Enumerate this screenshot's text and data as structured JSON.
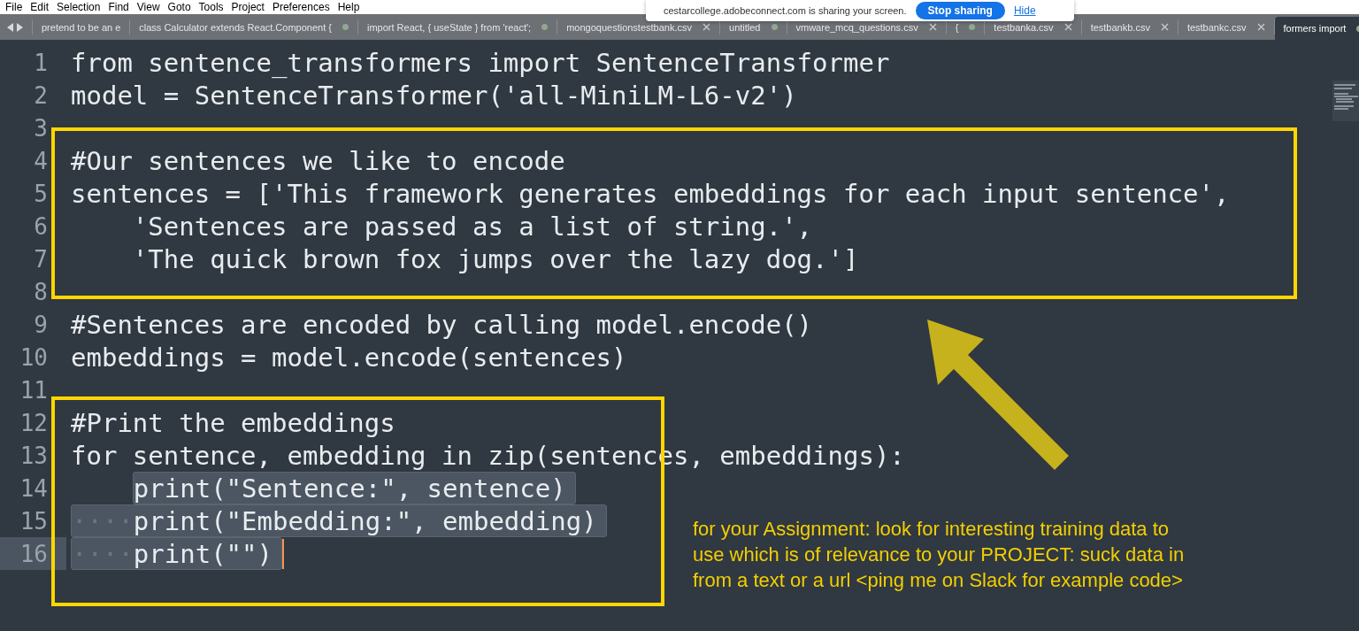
{
  "menu": [
    "File",
    "Edit",
    "Selection",
    "Find",
    "View",
    "Goto",
    "Tools",
    "Project",
    "Preferences",
    "Help"
  ],
  "share_banner": {
    "message": "cestarcollege.adobeconnect.com is sharing your screen.",
    "stop_button": "Stop sharing",
    "hide_link": "Hide"
  },
  "tabs": [
    {
      "label": "pretend to be an e",
      "kind": "plain",
      "selected": false
    },
    {
      "label": "class Calculator extends React.Component {",
      "kind": "unsaved",
      "selected": false
    },
    {
      "label": "import React, { useState } from 'react';",
      "kind": "unsaved",
      "selected": false
    },
    {
      "label": "mongoquestionstestbank.csv",
      "kind": "saved",
      "selected": false
    },
    {
      "label": "untitled",
      "kind": "unsaved",
      "selected": false
    },
    {
      "label": "vmware_mcq_questions.csv",
      "kind": "saved",
      "selected": false
    },
    {
      "label": "{",
      "kind": "unsaved",
      "selected": false
    },
    {
      "label": "testbanka.csv",
      "kind": "saved",
      "selected": false
    },
    {
      "label": "testbankb.csv",
      "kind": "saved",
      "selected": false
    },
    {
      "label": "testbankc.csv",
      "kind": "saved",
      "selected": false
    },
    {
      "label": "formers import",
      "kind": "unsaved",
      "selected": true
    }
  ],
  "lines": [
    {
      "number": "1",
      "text": "from sentence_transformers import SentenceTransformer",
      "selected": false,
      "current": false
    },
    {
      "number": "2",
      "text": "model = SentenceTransformer('all-MiniLM-L6-v2')",
      "selected": false,
      "current": false
    },
    {
      "number": "3",
      "selected": false,
      "current": false
    },
    {
      "number": "4",
      "text": "#Our sentences we like to encode",
      "selected": false,
      "current": false
    },
    {
      "number": "5",
      "text": "sentences = ['This framework generates embeddings for each input sentence',",
      "selected": false,
      "current": false
    },
    {
      "number": "6",
      "indented": true,
      "text": "'Sentences are passed as a list of string.',",
      "selected": false,
      "current": false
    },
    {
      "number": "7",
      "indented": true,
      "text": "'The quick brown fox jumps over the lazy dog.']",
      "selected": false,
      "current": false
    },
    {
      "number": "8",
      "selected": false,
      "current": false
    },
    {
      "number": "9",
      "text": "#Sentences are encoded by calling model.encode()",
      "selected": false,
      "current": false
    },
    {
      "number": "10",
      "text": "embeddings = model.encode(sentences)",
      "selected": false,
      "current": false
    },
    {
      "number": "11",
      "selected": false,
      "current": false
    },
    {
      "number": "12",
      "text": "#Print the embeddings",
      "selected": false,
      "current": false
    },
    {
      "number": "13",
      "text": "for sentence, embedding in zip(sentences, embeddings):",
      "selected": false,
      "current": false
    },
    {
      "number": "14",
      "indented": true,
      "text": "print(\"Sentence:\", sentence)",
      "selected": true,
      "indent_selected": false,
      "current": false
    },
    {
      "number": "15",
      "indent": "····",
      "text": "print(\"Embedding:\", embedding)",
      "selected": true,
      "indent_selected": true,
      "current": false
    },
    {
      "number": "16",
      "indent": "····",
      "text": "print(\"\")",
      "selected": true,
      "indent_selected": true,
      "current": true
    }
  ],
  "annotation": {
    "lines": [
      "for your Assignment: look for interesting training data to",
      "use which is of relevance to your PROJECT: suck data in",
      "from a text or a url <ping me on Slack for example code>"
    ]
  }
}
